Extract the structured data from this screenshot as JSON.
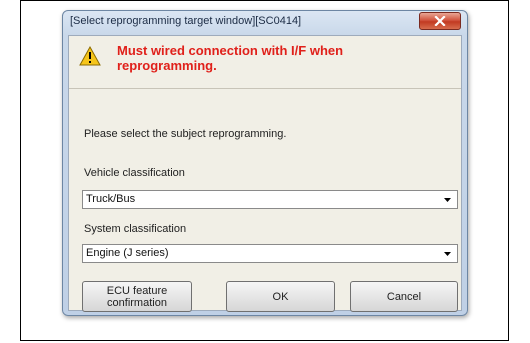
{
  "window": {
    "title": "[Select reprogramming target window][SC0414]"
  },
  "warning": {
    "icon": "warning-triangle-icon",
    "text": "Must wired connection with I/F when reprogramming."
  },
  "instruction": "Please select the subject reprogramming.",
  "vehicle_classification": {
    "label": "Vehicle classification",
    "selected": "Truck/Bus"
  },
  "system_classification": {
    "label": "System classification",
    "selected": "Engine (J series)"
  },
  "buttons": {
    "ecu_line1": "ECU feature",
    "ecu_line2": "confirmation",
    "ok": "OK",
    "cancel": "Cancel"
  },
  "colors": {
    "warning_text": "#e0201a",
    "close_button": "#c23a22",
    "dialog_background": "#f1efe6"
  }
}
